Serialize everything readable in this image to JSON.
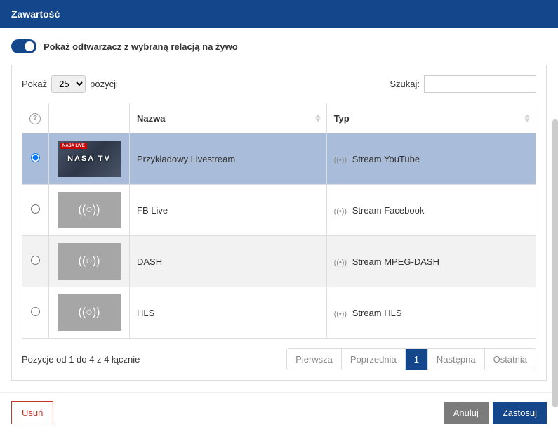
{
  "header": {
    "title": "Zawartość"
  },
  "toggle": {
    "label": "Pokaż odtwarzacz z wybraną relacją na żywo"
  },
  "table_controls": {
    "show_prefix": "Pokaż",
    "show_suffix": "pozycji",
    "page_size": "25",
    "search_label": "Szukaj:",
    "search_value": ""
  },
  "columns": {
    "help_label": "?",
    "name": "Nazwa",
    "type": "Typ"
  },
  "rows": [
    {
      "selected": true,
      "thumb": "nasa",
      "thumb_text": "NASA TV",
      "thumb_badge": "NASA LIVE",
      "name": "Przykładowy Livestream",
      "type": "Stream YouTube"
    },
    {
      "selected": false,
      "thumb": "placeholder",
      "thumb_glyph": "((○))",
      "name": "FB Live",
      "type": "Stream Facebook"
    },
    {
      "selected": false,
      "thumb": "placeholder",
      "thumb_glyph": "((○))",
      "name": "DASH",
      "type": "Stream MPEG-DASH"
    },
    {
      "selected": false,
      "thumb": "placeholder",
      "thumb_glyph": "((○))",
      "name": "HLS",
      "type": "Stream HLS"
    }
  ],
  "footer": {
    "info": "Pozycje od 1 do 4 z 4 łącznie",
    "pagination": {
      "first": "Pierwsza",
      "prev": "Poprzednia",
      "current": "1",
      "next": "Następna",
      "last": "Ostatnia"
    }
  },
  "buttons": {
    "delete": "Usuń",
    "cancel": "Anuluj",
    "apply": "Zastosuj"
  }
}
